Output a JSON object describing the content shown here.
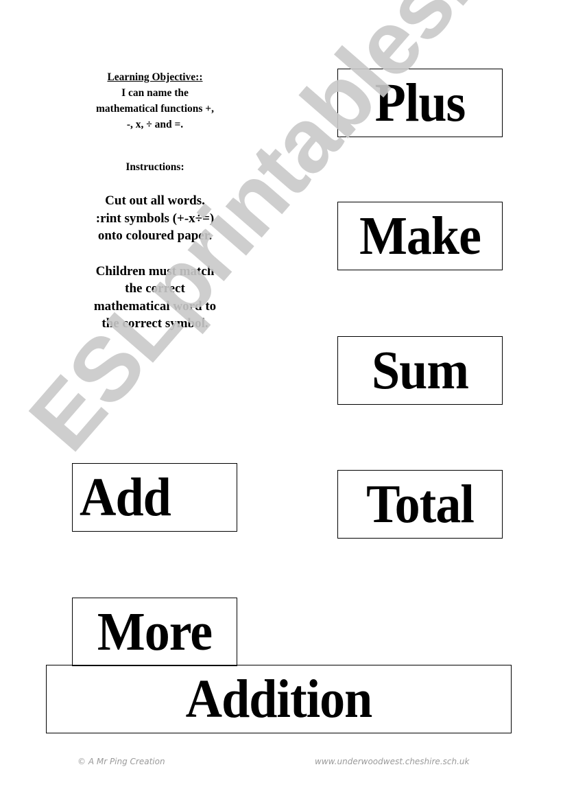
{
  "objective": {
    "heading": "Learning Objective::",
    "lines": [
      "I can name the",
      "mathematical functions +,",
      "-, x, ÷ and =."
    ]
  },
  "instructions": {
    "heading": "Instructions:",
    "paragraph1": [
      "Cut out all words.",
      ":rint symbols (+-x÷=)",
      "onto coloured paper."
    ],
    "paragraph2": [
      "Children must match",
      "the correct",
      "mathematical word to",
      "the correct symbol."
    ]
  },
  "cards": {
    "plus": "Plus",
    "make": "Make",
    "sum": "Sum",
    "add": "Add",
    "total": "Total",
    "more": "More",
    "addition": "Addition"
  },
  "watermark": "ESLprintables.com",
  "footer": {
    "credit": "© A Mr Ping Creation",
    "website": "www.underwoodwest.cheshire.sch.uk"
  }
}
